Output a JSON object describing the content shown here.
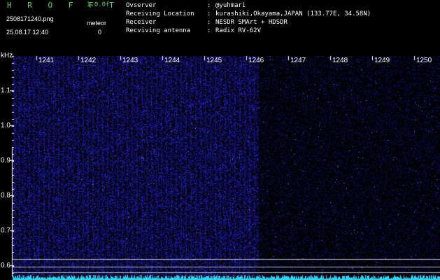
{
  "app": {
    "logo": "H R O F F T",
    "version": "1.0.0f",
    "filename": "2508171240.png",
    "timestamp": "25.08.17 12:40",
    "meteor_label": "meteor",
    "meteor_count": "0"
  },
  "info": [
    {
      "key": "Ovserver",
      "value": "@yuhmari"
    },
    {
      "key": "Receiving Location",
      "value": "kurashiki,Okayama,JAPAN (133.77E, 34.58N)"
    },
    {
      "key": "Receiver",
      "value": "NESDR SMArt + HDSDR"
    },
    {
      "key": "Recviving antenna",
      "value": "Radix RV-62V"
    }
  ],
  "spectrogram": {
    "freq_unit": "kHz",
    "x_ticks": [
      "1241",
      "1242",
      "1243",
      "1244",
      "1245",
      "1246",
      "1247",
      "1248",
      "1249",
      "1250"
    ],
    "y_ticks": [
      "1.1",
      "1.0",
      "0.9",
      "0.8",
      "0.7",
      "0.6"
    ],
    "colors": {
      "background": "#000000",
      "signal": "#1c1ca8",
      "grid": "#ffffff",
      "trace": "#2fd2f2",
      "logo": "#5fd35f"
    }
  }
}
